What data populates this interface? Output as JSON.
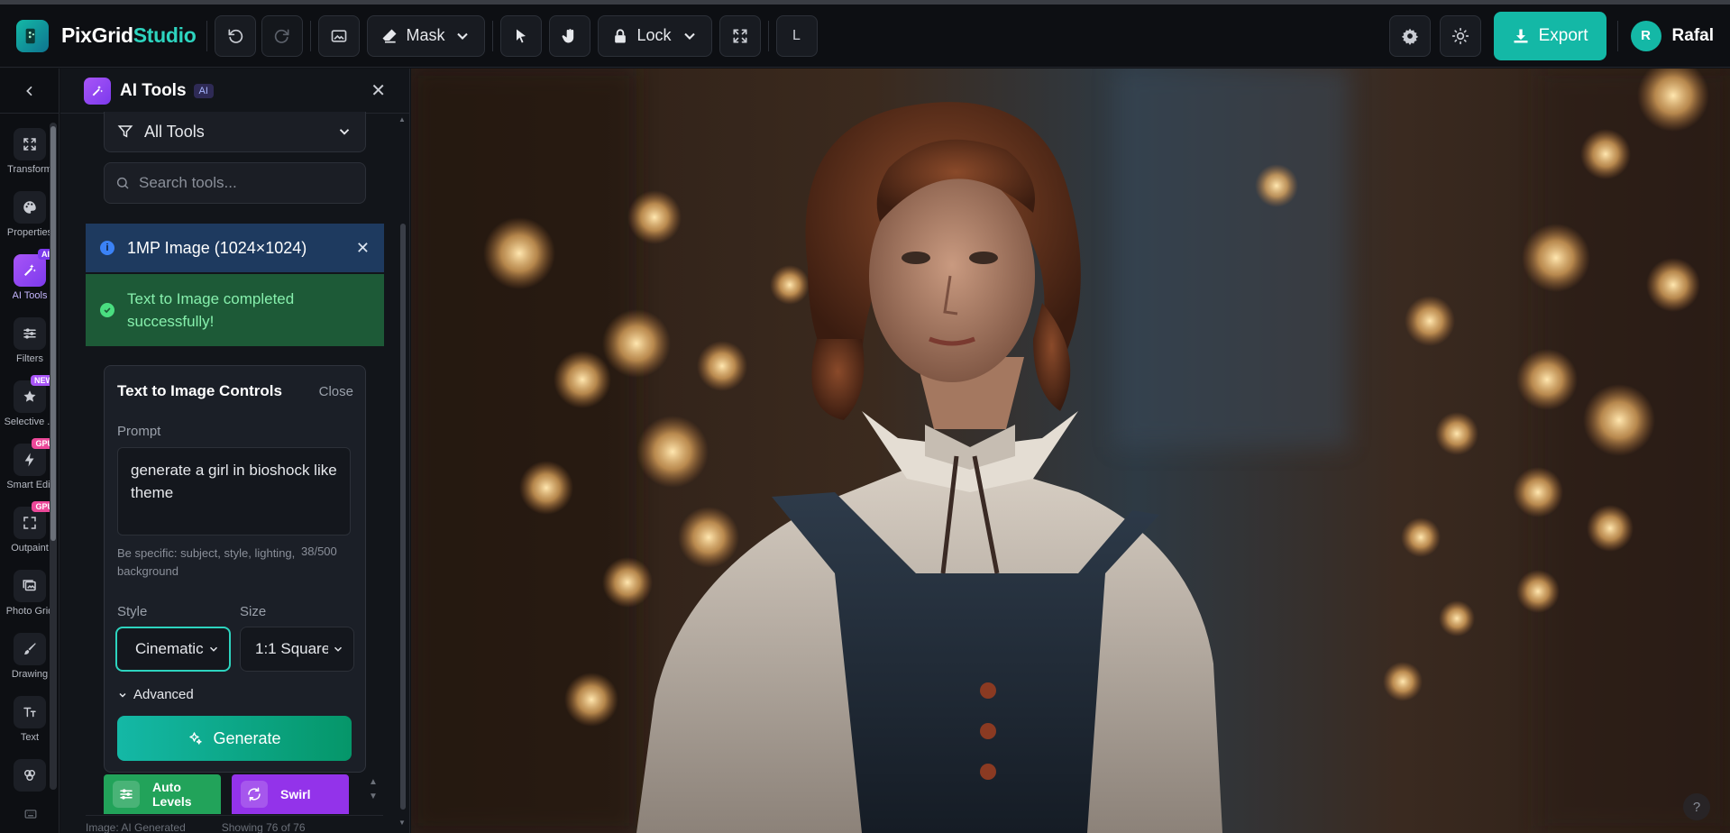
{
  "app": {
    "brand_primary": "PixGrid",
    "brand_accent": "Studio",
    "accent_color": "#14b8a6"
  },
  "toolbar": {
    "undo_icon": "undo-icon",
    "redo_icon": "redo-icon",
    "image_icon": "image-icon",
    "mask_label": "Mask",
    "lock_label": "Lock",
    "layer_key": "L",
    "export_label": "Export"
  },
  "user": {
    "initial": "R",
    "name": "Rafal"
  },
  "rail": {
    "items": [
      {
        "label": "Transform",
        "icon": "transform-icon"
      },
      {
        "label": "Properties",
        "icon": "palette-icon"
      },
      {
        "label": "AI Tools",
        "icon": "magic-wand-icon",
        "badge": "AI"
      },
      {
        "label": "Filters",
        "icon": "sliders-icon"
      },
      {
        "label": "Selective ...",
        "icon": "star-icon",
        "badge": "NEW"
      },
      {
        "label": "Smart Edit",
        "icon": "lightning-icon",
        "badge": "GPU"
      },
      {
        "label": "Outpaint",
        "icon": "expand-icon",
        "badge": "GPU"
      },
      {
        "label": "Photo Grid",
        "icon": "grid-image-icon"
      },
      {
        "label": "Drawing",
        "icon": "brush-icon"
      },
      {
        "label": "Text",
        "icon": "text-icon"
      }
    ]
  },
  "panel": {
    "title": "AI Tools",
    "tag": "AI",
    "filter_label": "All Tools",
    "search_placeholder": "Search tools...",
    "info_text": "1MP Image (1024×1024)",
    "success_text": "Text to Image completed successfully!",
    "controls": {
      "title": "Text to Image Controls",
      "close_label": "Close",
      "prompt_label": "Prompt",
      "prompt_value": "generate a girl in bioshock like theme",
      "hint": "Be specific: subject, style, lighting, background",
      "counter": "38/500",
      "style_label": "Style",
      "style_value": "Cinematic",
      "size_label": "Size",
      "size_value": "1:1 Square",
      "advanced_label": "Advanced",
      "generate_label": "Generate"
    },
    "tool_cards": [
      {
        "label": "Auto Levels",
        "color": "#22a35a"
      },
      {
        "label": "Swirl",
        "color": "#9333ea"
      }
    ],
    "footer_left": "Image: AI Generated",
    "footer_right": "Showing 76 of 76"
  },
  "canvas": {
    "help_label": "?"
  }
}
